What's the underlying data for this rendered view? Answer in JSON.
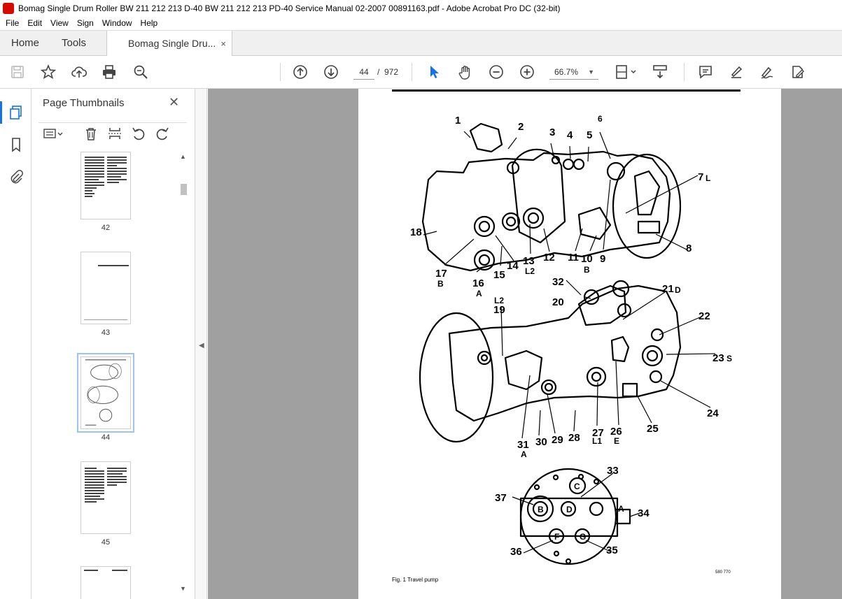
{
  "window": {
    "title": "Bomag Single Drum Roller BW 211 212 213 D-40 BW 211 212 213 PD-40 Service Manual 02-2007 00891163.pdf - Adobe Acrobat Pro DC (32-bit)"
  },
  "menu": [
    "File",
    "Edit",
    "View",
    "Sign",
    "Window",
    "Help"
  ],
  "tabs": {
    "home": "Home",
    "tools": "Tools",
    "doc": "Bomag Single Dru...",
    "close": "×"
  },
  "toolbar": {
    "current_page": "44",
    "page_sep": "/",
    "total_pages": "972",
    "zoom": "66.7%",
    "icons": [
      "save-icon",
      "star-icon",
      "upload-icon",
      "print-icon",
      "zoom-search-icon",
      "prev-page-icon",
      "next-page-icon",
      "select-cursor-icon",
      "hand-icon",
      "zoom-out-icon",
      "zoom-in-icon",
      "fit-page-icon",
      "scroll-mode-icon",
      "comment-icon",
      "highlight-icon",
      "sign-icon",
      "edit-pdf-icon"
    ]
  },
  "panel": {
    "title": "Page Thumbnails",
    "close": "✕",
    "thumbnails": [
      {
        "label": "42"
      },
      {
        "label": "43"
      },
      {
        "label": "44"
      },
      {
        "label": "45"
      }
    ]
  },
  "page": {
    "caption": "Fig. 1 Travel pump",
    "figure_number": "580 770",
    "callouts": [
      {
        "text": "1"
      },
      {
        "text": "2"
      },
      {
        "text": "3"
      },
      {
        "text": "4"
      },
      {
        "text": "5"
      },
      {
        "text": "6"
      },
      {
        "text": "7"
      },
      {
        "text": "L"
      },
      {
        "text": "8"
      },
      {
        "text": "9"
      },
      {
        "text": "10"
      },
      {
        "text": "B"
      },
      {
        "text": "11"
      },
      {
        "text": "12"
      },
      {
        "text": "13"
      },
      {
        "text": "L2"
      },
      {
        "text": "14"
      },
      {
        "text": "15"
      },
      {
        "text": "16"
      },
      {
        "text": "A"
      },
      {
        "text": "17"
      },
      {
        "text": "B"
      },
      {
        "text": "18"
      },
      {
        "text": "32"
      },
      {
        "text": "21"
      },
      {
        "text": "D"
      },
      {
        "text": "L2"
      },
      {
        "text": "20"
      },
      {
        "text": "19"
      },
      {
        "text": "22"
      },
      {
        "text": "23"
      },
      {
        "text": "S"
      },
      {
        "text": "24"
      },
      {
        "text": "25"
      },
      {
        "text": "26"
      },
      {
        "text": "E"
      },
      {
        "text": "27"
      },
      {
        "text": "L1"
      },
      {
        "text": "28"
      },
      {
        "text": "29"
      },
      {
        "text": "30"
      },
      {
        "text": "31"
      },
      {
        "text": "A"
      },
      {
        "text": "33"
      },
      {
        "text": "37"
      },
      {
        "text": "34"
      },
      {
        "text": "36"
      },
      {
        "text": "35"
      },
      {
        "text": "C"
      },
      {
        "text": "B"
      },
      {
        "text": "D"
      },
      {
        "text": "A"
      },
      {
        "text": "F"
      },
      {
        "text": "G"
      }
    ]
  }
}
